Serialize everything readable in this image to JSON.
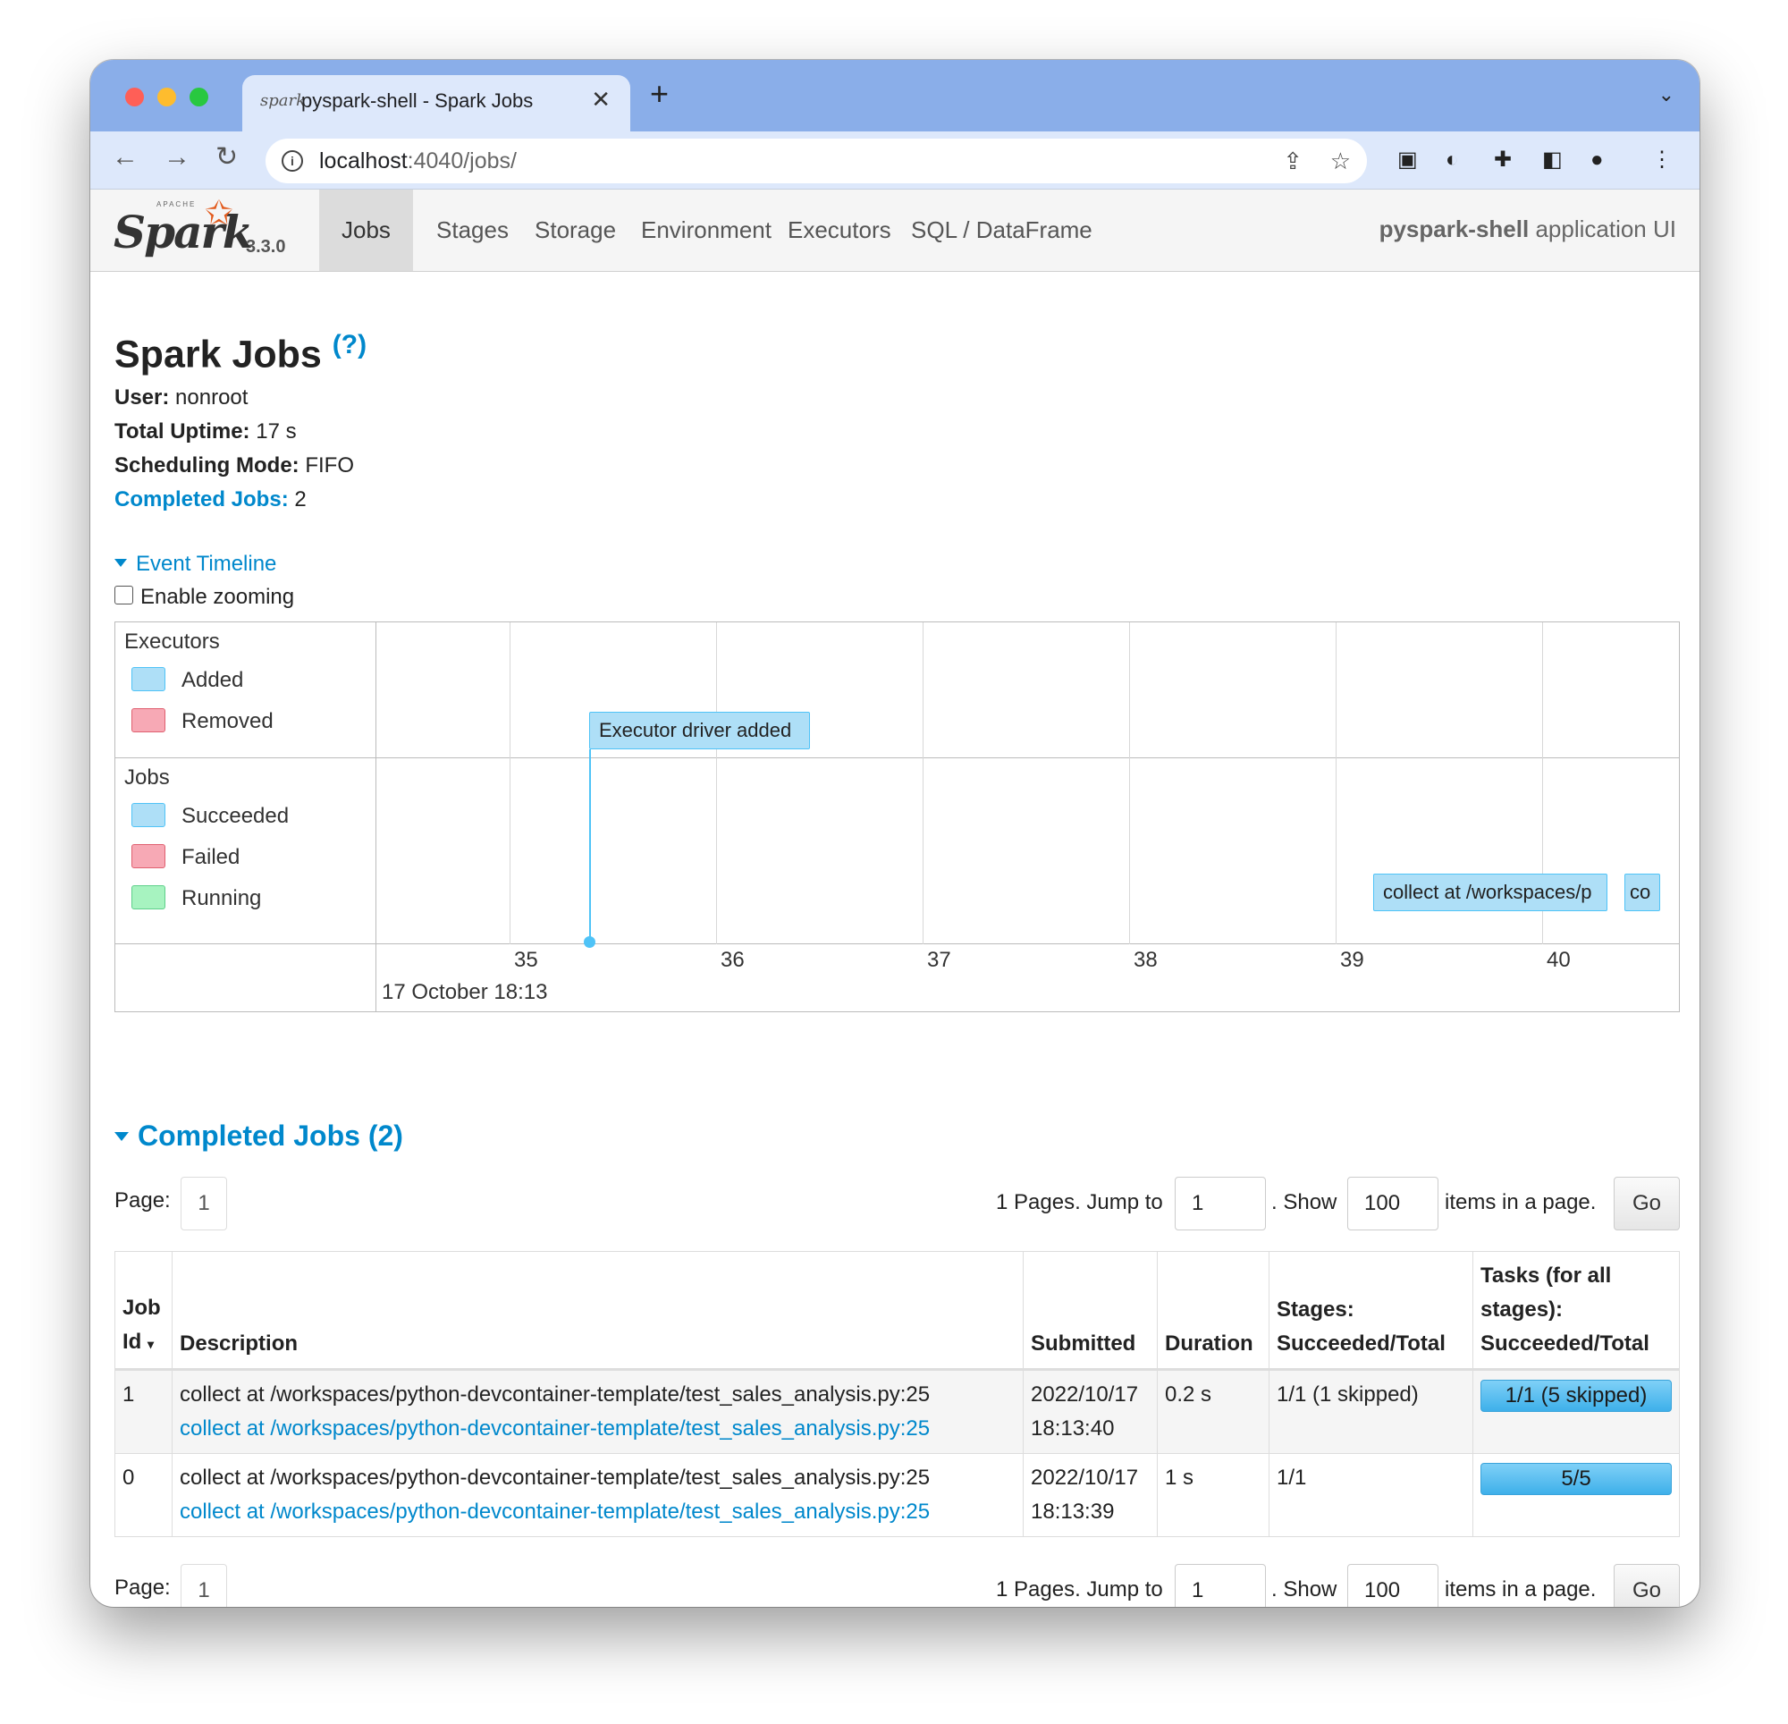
{
  "browser": {
    "tab_title": "pyspark-shell - Spark Jobs",
    "favicon_text": "spark",
    "url_host": "localhost",
    "url_path": ":4040/jobs/"
  },
  "spark_nav": {
    "logo_text": "Spark",
    "logo_apache": "APACHE",
    "version": "3.3.0",
    "items": [
      {
        "label": "Jobs",
        "active": true
      },
      {
        "label": "Stages"
      },
      {
        "label": "Storage"
      },
      {
        "label": "Environment"
      },
      {
        "label": "Executors"
      },
      {
        "label": "SQL / DataFrame"
      }
    ],
    "app_name": "pyspark-shell",
    "app_suffix": "application UI"
  },
  "page": {
    "title": "Spark Jobs",
    "help": "(?)",
    "user_label": "User:",
    "user_value": "nonroot",
    "uptime_label": "Total Uptime:",
    "uptime_value": "17 s",
    "sched_label": "Scheduling Mode:",
    "sched_value": "FIFO",
    "completed_label": "Completed Jobs:",
    "completed_value": "2"
  },
  "timeline": {
    "toggle_label": "Event Timeline",
    "zoom_label": "Enable zooming",
    "executors_title": "Executors",
    "executor_legend": [
      "Added",
      "Removed"
    ],
    "jobs_title": "Jobs",
    "job_legend": [
      "Succeeded",
      "Failed",
      "Running"
    ],
    "ticks": [
      "35",
      "36",
      "37",
      "38",
      "39",
      "40"
    ],
    "date_label": "17 October 18:13",
    "executor_event": "Executor driver added",
    "job_events": [
      "collect at /workspaces/p",
      "co"
    ],
    "colors": {
      "added": "#aedff7",
      "removed": "#f7a9b5",
      "running": "#a7f3c0"
    }
  },
  "completed_jobs": {
    "title": "Completed Jobs (2)",
    "pager": {
      "page_label": "Page:",
      "current_page": "1",
      "pages_text": "1 Pages. Jump to",
      "jump_value": "1",
      "show_text": ". Show",
      "show_value": "100",
      "items_text": "items in a page.",
      "go_label": "Go"
    },
    "columns": {
      "job_id": "Job Id",
      "sort_indicator": "▾",
      "description": "Description",
      "submitted": "Submitted",
      "duration": "Duration",
      "stages": "Stages: Succeeded/Total",
      "tasks": "Tasks (for all stages): Succeeded/Total"
    },
    "rows": [
      {
        "id": "1",
        "desc": "collect at /workspaces/python-devcontainer-template/test_sales_analysis.py:25",
        "desc_link": "collect at /workspaces/python-devcontainer-template/test_sales_analysis.py:25",
        "submitted_date": "2022/10/17",
        "submitted_time": "18:13:40",
        "duration": "0.2 s",
        "stages": "1/1 (1 skipped)",
        "tasks": "1/1 (5 skipped)",
        "tasks_fraction": 1.0
      },
      {
        "id": "0",
        "desc": "collect at /workspaces/python-devcontainer-template/test_sales_analysis.py:25",
        "desc_link": "collect at /workspaces/python-devcontainer-template/test_sales_analysis.py:25",
        "submitted_date": "2022/10/17",
        "submitted_time": "18:13:39",
        "duration": "1 s",
        "stages": "1/1",
        "tasks": "5/5",
        "tasks_fraction": 1.0
      }
    ]
  }
}
